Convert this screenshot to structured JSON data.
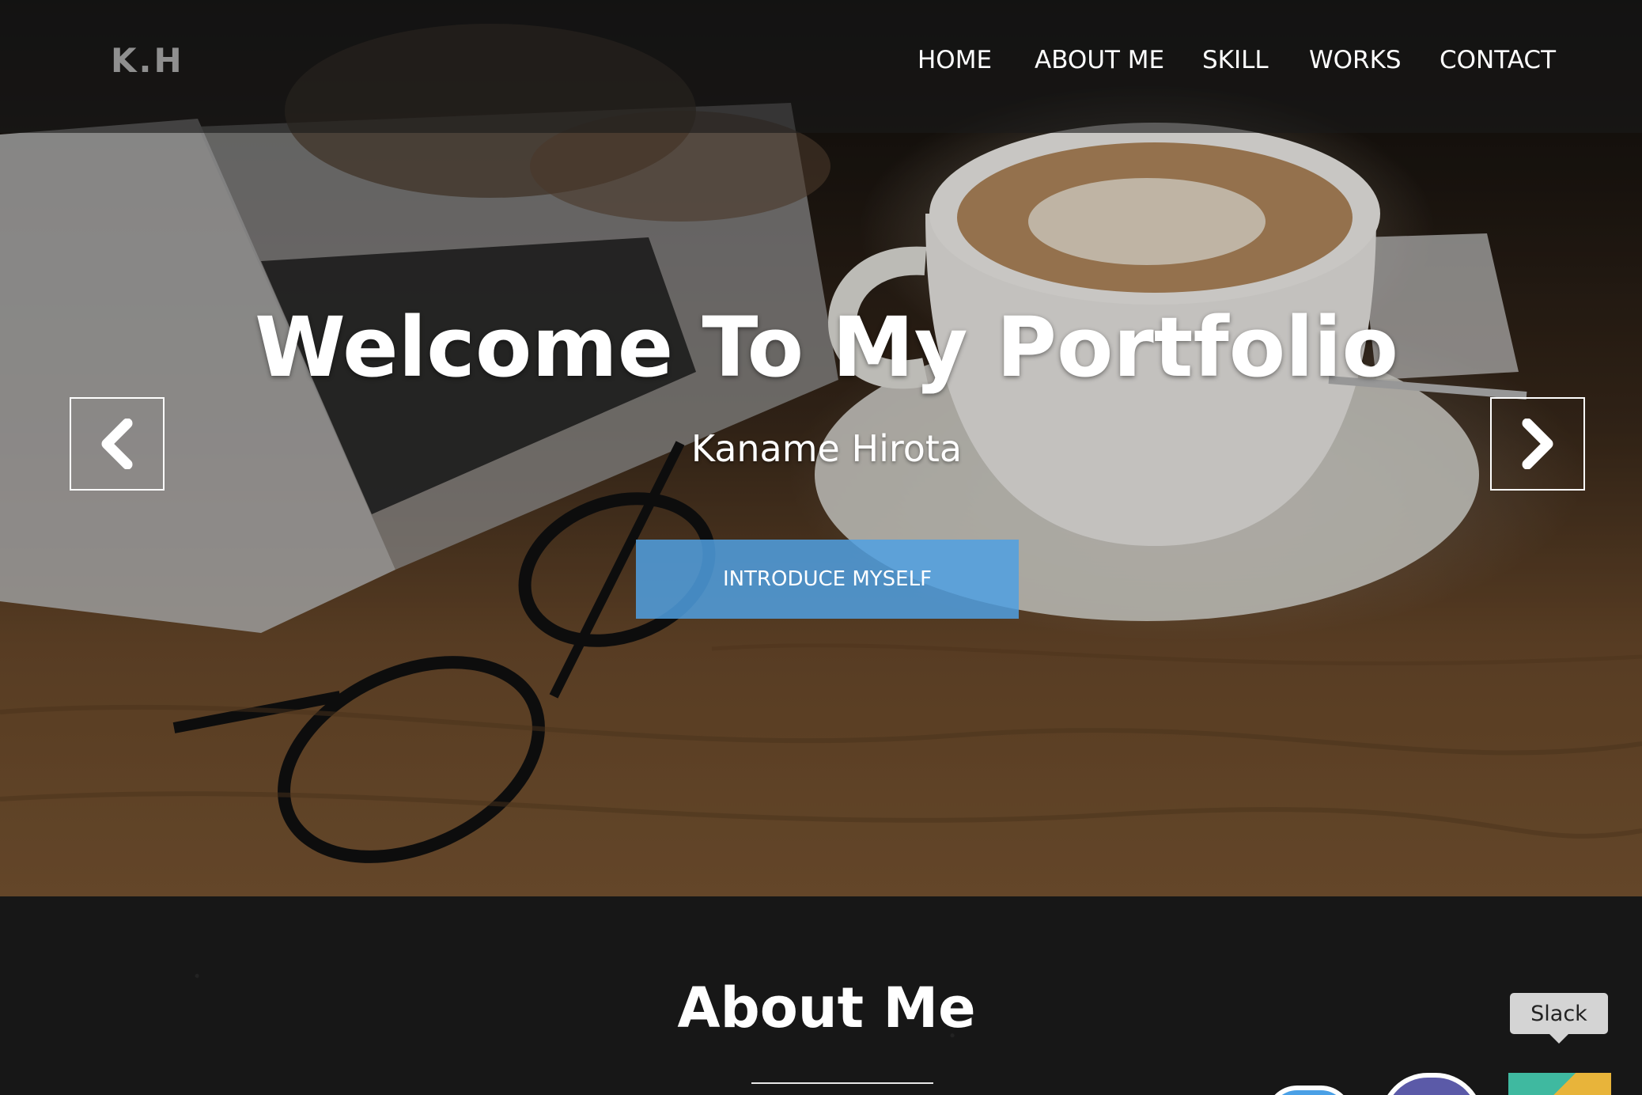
{
  "header": {
    "logo": "K.H",
    "nav": [
      {
        "label": "HOME"
      },
      {
        "label": "ABOUT ME"
      },
      {
        "label": "SKILL"
      },
      {
        "label": "WORKS"
      },
      {
        "label": "CONTACT"
      }
    ]
  },
  "hero": {
    "title": "Welcome To My Portfolio",
    "subtitle": "Kaname Hirota",
    "cta_label": "INTRODUCE MYSELF",
    "prev_icon": "chevron-left-icon",
    "next_icon": "chevron-right-icon"
  },
  "about": {
    "title": "About Me"
  },
  "tooltip": {
    "label": "Slack"
  },
  "colors": {
    "accent": "#50a0e2",
    "nav_bar": "#1a1a1a",
    "section_bg": "#171717"
  }
}
